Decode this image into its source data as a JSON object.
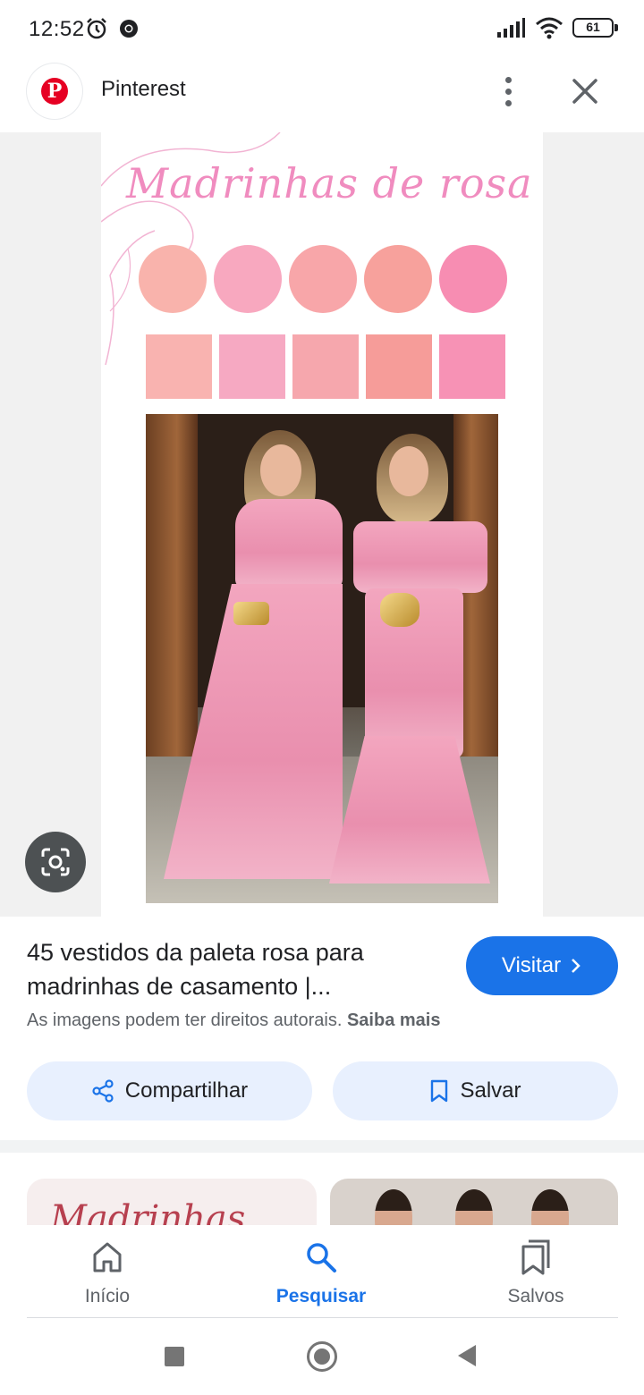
{
  "status_bar": {
    "time": "12:52",
    "battery": "61"
  },
  "header": {
    "site_name": "Pinterest",
    "logo_letter": "P"
  },
  "pin_image": {
    "overlay_title": "Madrinhas de rosa",
    "circle_swatches": [
      "#f9b3ac",
      "#f8a8bf",
      "#f8a6a9",
      "#f7a19c",
      "#f78db2"
    ],
    "square_swatches": [
      "#f9b3b0",
      "#f6a9c2",
      "#f6a7ad",
      "#f69c99",
      "#f792b5"
    ]
  },
  "result": {
    "title": "45 vestidos da paleta rosa para madrinhas de casamento |...",
    "visit_label": "Visitar",
    "copyright_text": "As imagens podem ter direitos autorais.",
    "learn_more": "Saiba mais",
    "share_label": "Compartilhar",
    "save_label": "Salvar"
  },
  "related": {
    "first_script": "Madrinhas"
  },
  "bottom_nav": {
    "items": [
      {
        "label": "Início",
        "icon": "home-icon",
        "active": false
      },
      {
        "label": "Pesquisar",
        "icon": "search-icon",
        "active": true
      },
      {
        "label": "Salvos",
        "icon": "bookmarks-icon",
        "active": false
      }
    ]
  },
  "colors": {
    "accent": "#1a73e8",
    "chip_bg": "#e8f0fe",
    "pinterest_red": "#e60023"
  }
}
